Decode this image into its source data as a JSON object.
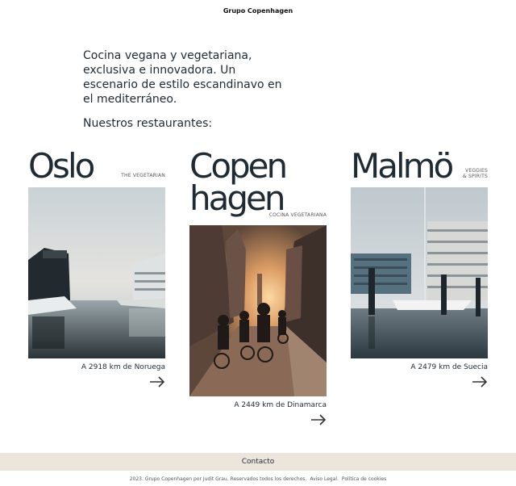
{
  "header": {
    "brand": "Grupo Copenhagen"
  },
  "intro": {
    "text": "Cocina vegana y vegetariana, exclusiva e innovadora. Un escenario de estilo escandinavo en el mediterráneo.",
    "restaurants_heading": "Nuestros restaurantes:"
  },
  "restaurants": [
    {
      "name": "Oslo",
      "tag_line1": "THE VEGETARIAN",
      "tag_line2": "",
      "distance": "A 2918 km de Noruega"
    },
    {
      "name_line1": "Copen",
      "name_line2": "hagen",
      "tag_line1": "COCINA VEGETARIANA",
      "tag_line2": "",
      "distance": "A 2449 km de Dinamarca"
    },
    {
      "name": "Malmö",
      "tag_line1": "VEGGIES",
      "tag_line2": "& SPIRITS",
      "distance": "A 2479 km de Suecia"
    }
  ],
  "footer": {
    "contact_label": "Contacto",
    "copyright": "2023. Grupo Copenhagen por Judit Grau. Reservados todos los derechos.",
    "legal_link": "Aviso Legal.",
    "cookies_link": "Política de cookies"
  },
  "icons": {
    "arrow": "arrow-right-icon"
  }
}
